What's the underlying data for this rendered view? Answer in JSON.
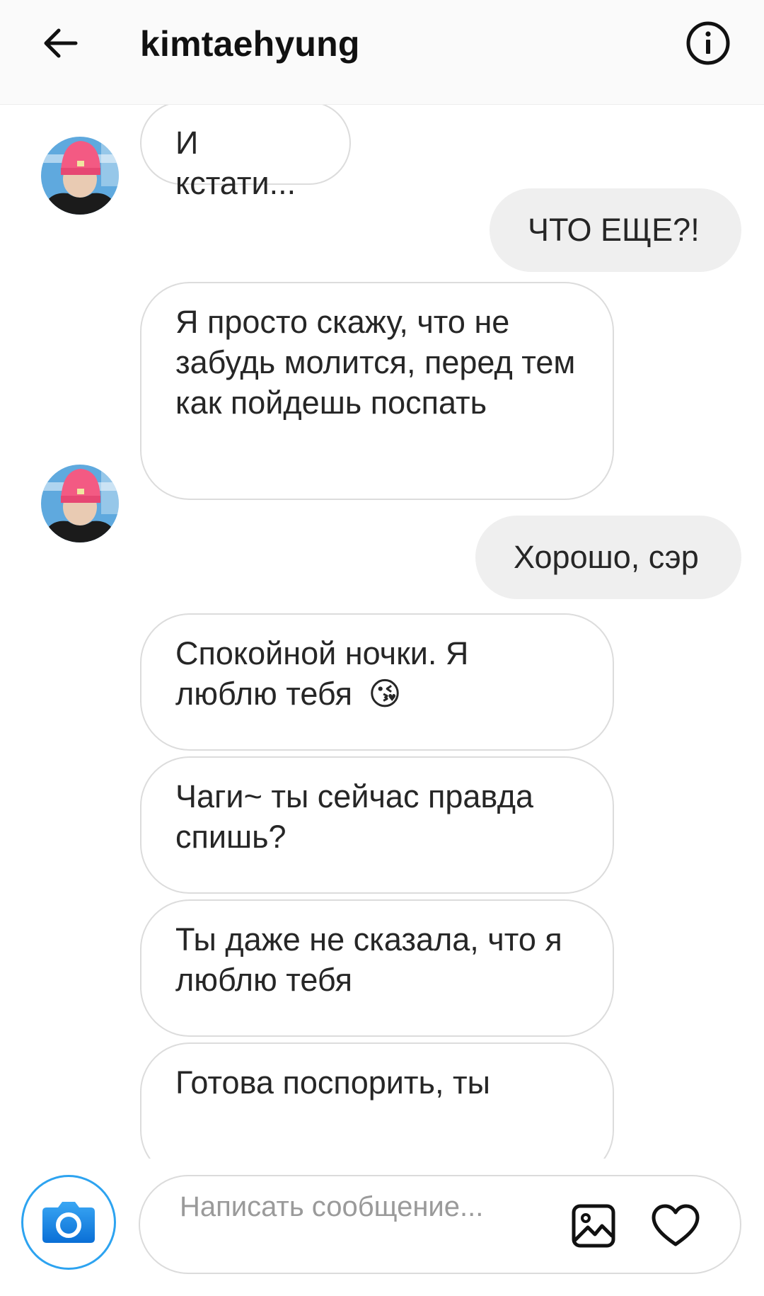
{
  "header": {
    "title": "kimtaehyung",
    "back_icon": "arrow-left-icon",
    "info_icon": "info-circle-icon"
  },
  "messages": [
    {
      "direction": "incoming",
      "text": "И кстати...",
      "avatar": true
    },
    {
      "direction": "outgoing",
      "text": "ЧТО ЕЩЕ?!"
    },
    {
      "direction": "incoming",
      "text": "Я просто скажу, что не забудь молится, перед тем как пойдешь поспать",
      "avatar": true
    },
    {
      "direction": "outgoing",
      "text": "Хорошо, сэр"
    },
    {
      "direction": "incoming",
      "text": "Спокойной ночки. Я люблю тебя",
      "emoji": "😘"
    },
    {
      "direction": "incoming",
      "text": "Чаги~ ты сейчас правда спишь?"
    },
    {
      "direction": "incoming",
      "text": "Ты даже не сказала, что я люблю тебя"
    },
    {
      "direction": "incoming",
      "text": "Готова поспорить, ты"
    }
  ],
  "composer": {
    "placeholder": "Написать сообщение...",
    "value": "",
    "camera_icon": "camera-icon",
    "gallery_icon": "image-gallery-icon",
    "like_icon": "heart-icon"
  },
  "colors": {
    "header_bg": "#fafafa",
    "incoming_border": "#dcdcdc",
    "outgoing_bg": "#efefef",
    "camera_accent": "#2da3f0"
  }
}
